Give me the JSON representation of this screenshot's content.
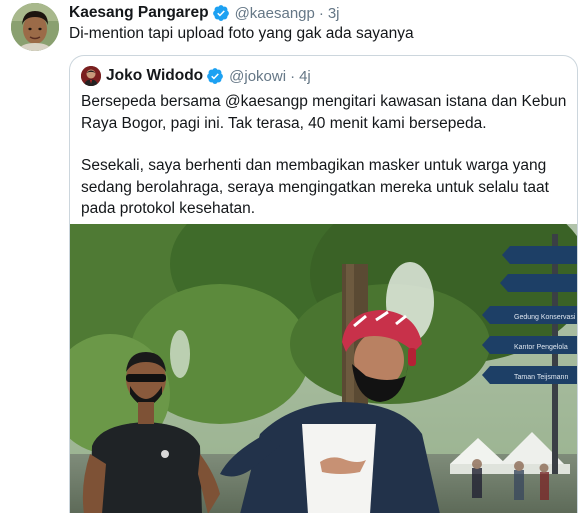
{
  "tweet": {
    "author_name": "Kaesang Pangarep",
    "author_handle": "@kaesangp",
    "separator": "·",
    "time": "3j",
    "text": "Di-mention tapi upload foto yang gak ada sayanya"
  },
  "quoted": {
    "author_name": "Joko Widodo",
    "author_handle": "@jokowi",
    "separator": "·",
    "time": "4j",
    "paragraph_1": "Bersepeda bersama @kaesangp mengitari kawasan istana dan Kebun Raya Bogor, pagi ini. Tak terasa, 40 menit kami bersepeda.",
    "paragraph_2": "Sesekali, saya berhenti dan membagikan masker untuk warga yang sedang berolahraga, seraya mengingatkan mereka untuk selalu taat pada protokol kesehatan.",
    "signs": [
      "Gedung Konservasi",
      "Kantor Pengelola",
      "Taman Teijsmann"
    ]
  },
  "colors": {
    "verified": "#1da1f2",
    "secondary_text": "#657786",
    "border": "#ccd6dd"
  },
  "icons": {
    "verified": "verified-badge-icon"
  }
}
